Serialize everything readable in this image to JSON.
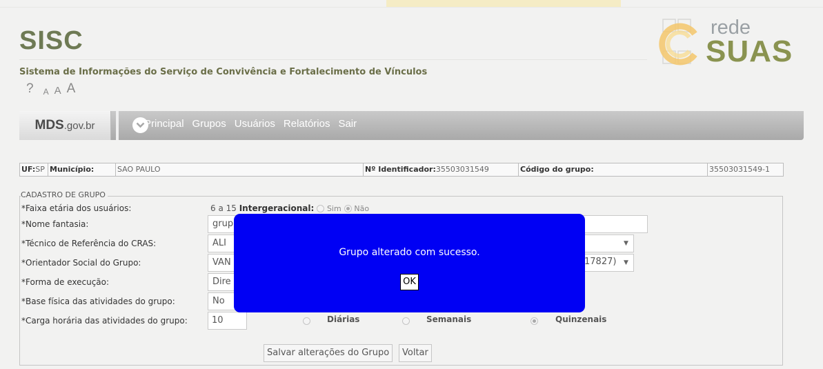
{
  "header": {
    "title": "SISC",
    "subtitle": "Sistema de Informações do Serviço de Convivência e Fortalecimento de Vínculos",
    "font_tools": {
      "help": "?",
      "small": "A",
      "medium": "A",
      "large": "A"
    }
  },
  "logo": {
    "line1": "rede",
    "line2": "SUAS"
  },
  "nav": {
    "mds_bold": "MDS",
    "mds_rest": ".gov.br",
    "items": [
      "Principal",
      "Grupos",
      "Usuários",
      "Relatórios",
      "Sair"
    ]
  },
  "info": {
    "uf_label": "UF:",
    "uf_value": "SP",
    "municipio_label": "Município:",
    "municipio_value": "SAO PAULO",
    "identificador_label": "Nº Identificador:",
    "identificador_value": "35503031549",
    "codigo_label": "Código do grupo:",
    "codigo_value": "35503031549-1"
  },
  "form": {
    "legend": "CADASTRO DE GRUPO",
    "faixa_label": "*Faixa etária dos usuários:",
    "faixa_value": "6 a 15",
    "intergeracional_label": "Intergeracional:",
    "sim_label": "Sim",
    "nao_label": "Não",
    "nome_label": "*Nome fantasia:",
    "nome_value": "grup",
    "tecnico_label": "*Técnico de Referência do CRAS:",
    "tecnico_value": "ALI",
    "orientador_label": "*Orientador Social do Grupo:",
    "orientador_value": "VAN",
    "orientador_suffix": "17827)",
    "forma_label": "*Forma de execução:",
    "forma_value": "Dire",
    "base_label": "*Base física das atividades do grupo:",
    "base_value": "No",
    "carga_label": "*Carga horária das atividades do grupo:",
    "carga_value": "10",
    "diarias_label": "Diárias",
    "semanais_label": "Semanais",
    "quinzenais_label": "Quinzenais",
    "save_label": "Salvar alterações do Grupo",
    "back_label": "Voltar"
  },
  "modal": {
    "message": "Grupo alterado com sucesso.",
    "ok_label": "OK"
  },
  "colors": {
    "modal_bg": "#0000f4",
    "brand": "#6e7a54",
    "navbar": "#b5b5b5"
  }
}
